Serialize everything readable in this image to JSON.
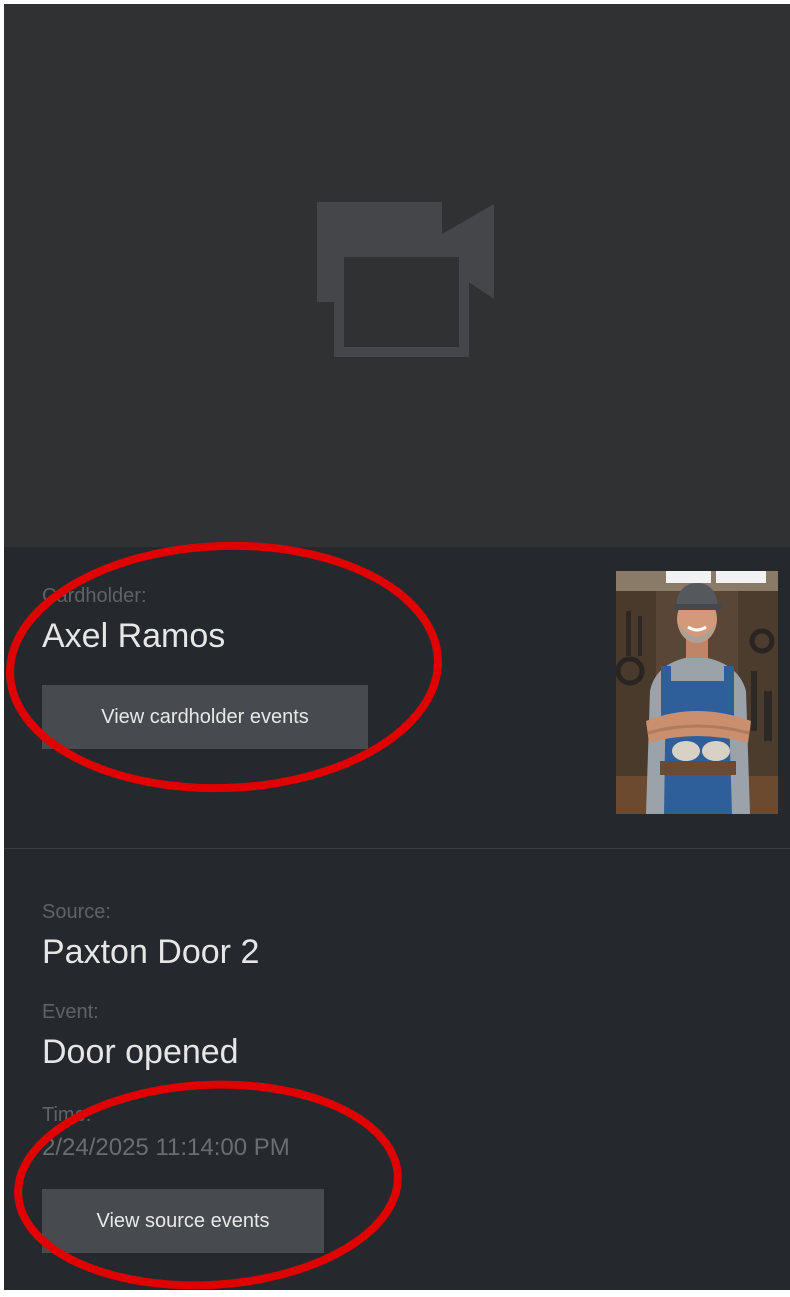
{
  "video": {
    "placeholder_icon": "video-camera-placeholder-icon"
  },
  "cardholder": {
    "label": "Cardholder:",
    "name": "Axel Ramos",
    "button_label": "View cardholder events",
    "photo_icon": "cardholder-photo"
  },
  "source": {
    "label": "Source:",
    "value": "Paxton Door 2",
    "event_label": "Event:",
    "event_value": "Door opened",
    "time_label": "Time:",
    "time_value": "2/24/2025 11:14:00 PM",
    "button_label": "View source events"
  },
  "annotations": {
    "color": "#e00000"
  },
  "colors": {
    "panel_bg": "#25282c",
    "video_bg": "#303133",
    "button_bg": "#474a4f",
    "label_text": "#5f6368",
    "value_text": "#e6e6e6"
  }
}
